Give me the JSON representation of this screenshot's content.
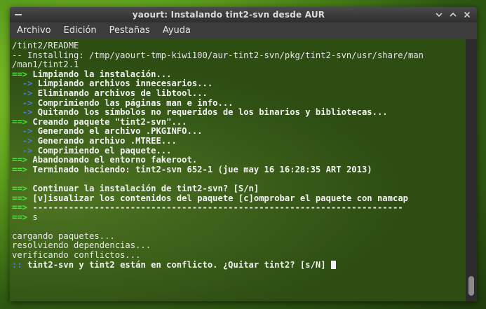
{
  "window": {
    "title": "yaourt: Instalando tint2-svn desde AUR",
    "menu_icon": "terminal-menu-icon",
    "buttons": {
      "restore": "–",
      "minimize": "▴",
      "maximize": "▴",
      "close": "✕"
    }
  },
  "menubar": {
    "items": [
      "Archivo",
      "Edición",
      "Pestañas",
      "Ayuda"
    ]
  },
  "terminal": {
    "lines": [
      {
        "arrow": "",
        "arrow_color": "",
        "text": "/tint2/README",
        "bold": false
      },
      {
        "arrow": "",
        "arrow_color": "",
        "text": "-- Installing: /tmp/yaourt-tmp-kiwi100/aur-tint2-svn/pkg/tint2-svn/usr/share/man",
        "bold": false
      },
      {
        "arrow": "",
        "arrow_color": "",
        "text": "/man1/tint2.1",
        "bold": false
      },
      {
        "arrow": "==>",
        "arrow_color": "green",
        "text": " Limpiando la instalación...",
        "bold": true
      },
      {
        "arrow": "  ->",
        "arrow_color": "blue",
        "text": " Limpiando archivos innecesarios...",
        "bold": true
      },
      {
        "arrow": "  ->",
        "arrow_color": "blue",
        "text": " Eliminando archivos de libtool...",
        "bold": true
      },
      {
        "arrow": "  ->",
        "arrow_color": "blue",
        "text": " Comprimiendo las páginas man e info...",
        "bold": true
      },
      {
        "arrow": "  ->",
        "arrow_color": "blue",
        "text": " Quitando los símbolos no requeridos de los binarios y bibliotecas...",
        "bold": true
      },
      {
        "arrow": "==>",
        "arrow_color": "green",
        "text": " Creando paquete \"tint2-svn\"...",
        "bold": true
      },
      {
        "arrow": "  ->",
        "arrow_color": "blue",
        "text": " Generando el archivo .PKGINFO...",
        "bold": true
      },
      {
        "arrow": "  ->",
        "arrow_color": "blue",
        "text": " Generando archivo .MTREE...",
        "bold": true
      },
      {
        "arrow": "  ->",
        "arrow_color": "blue",
        "text": " Comprimiendo el paquete...",
        "bold": true
      },
      {
        "arrow": "==>",
        "arrow_color": "green",
        "text": " Abandonando el entorno fakeroot.",
        "bold": true
      },
      {
        "arrow": "==>",
        "arrow_color": "green",
        "text": " Terminado haciendo: tint2-svn 652-1 (jue may 16 16:28:35 ART 2013)",
        "bold": true
      },
      {
        "arrow": "",
        "arrow_color": "",
        "text": "",
        "bold": false
      },
      {
        "arrow": "==>",
        "arrow_color": "green",
        "text": " Continuar la instalación de tint2-svn? [S/n]",
        "bold": true
      },
      {
        "arrow": "==>",
        "arrow_color": "green",
        "text": " [v]isualizar los contenidos del paquete [c]omprobar el paquete con namcap",
        "bold": true
      },
      {
        "arrow": "==>",
        "arrow_color": "green",
        "text": " ------------------------------------------------------------------------",
        "bold": true
      },
      {
        "arrow": "==>",
        "arrow_color": "green",
        "text": " s",
        "bold": false
      },
      {
        "arrow": "",
        "arrow_color": "",
        "text": "",
        "bold": false
      },
      {
        "arrow": "",
        "arrow_color": "",
        "text": "cargando paquetes...",
        "bold": false
      },
      {
        "arrow": "",
        "arrow_color": "",
        "text": "resolviendo dependencias...",
        "bold": false
      },
      {
        "arrow": "",
        "arrow_color": "",
        "text": "verificando conflictos...",
        "bold": false
      },
      {
        "arrow": "::",
        "arrow_color": "blue",
        "text": " tint2-svn y tint2 están en conflicto. ¿Quitar tint2? [s/N] ",
        "bold": true
      }
    ]
  },
  "colors": {
    "green_arrow": "#4be23a",
    "blue_arrow": "#4c7bd6",
    "terminal_bg": "#2d4d13"
  }
}
